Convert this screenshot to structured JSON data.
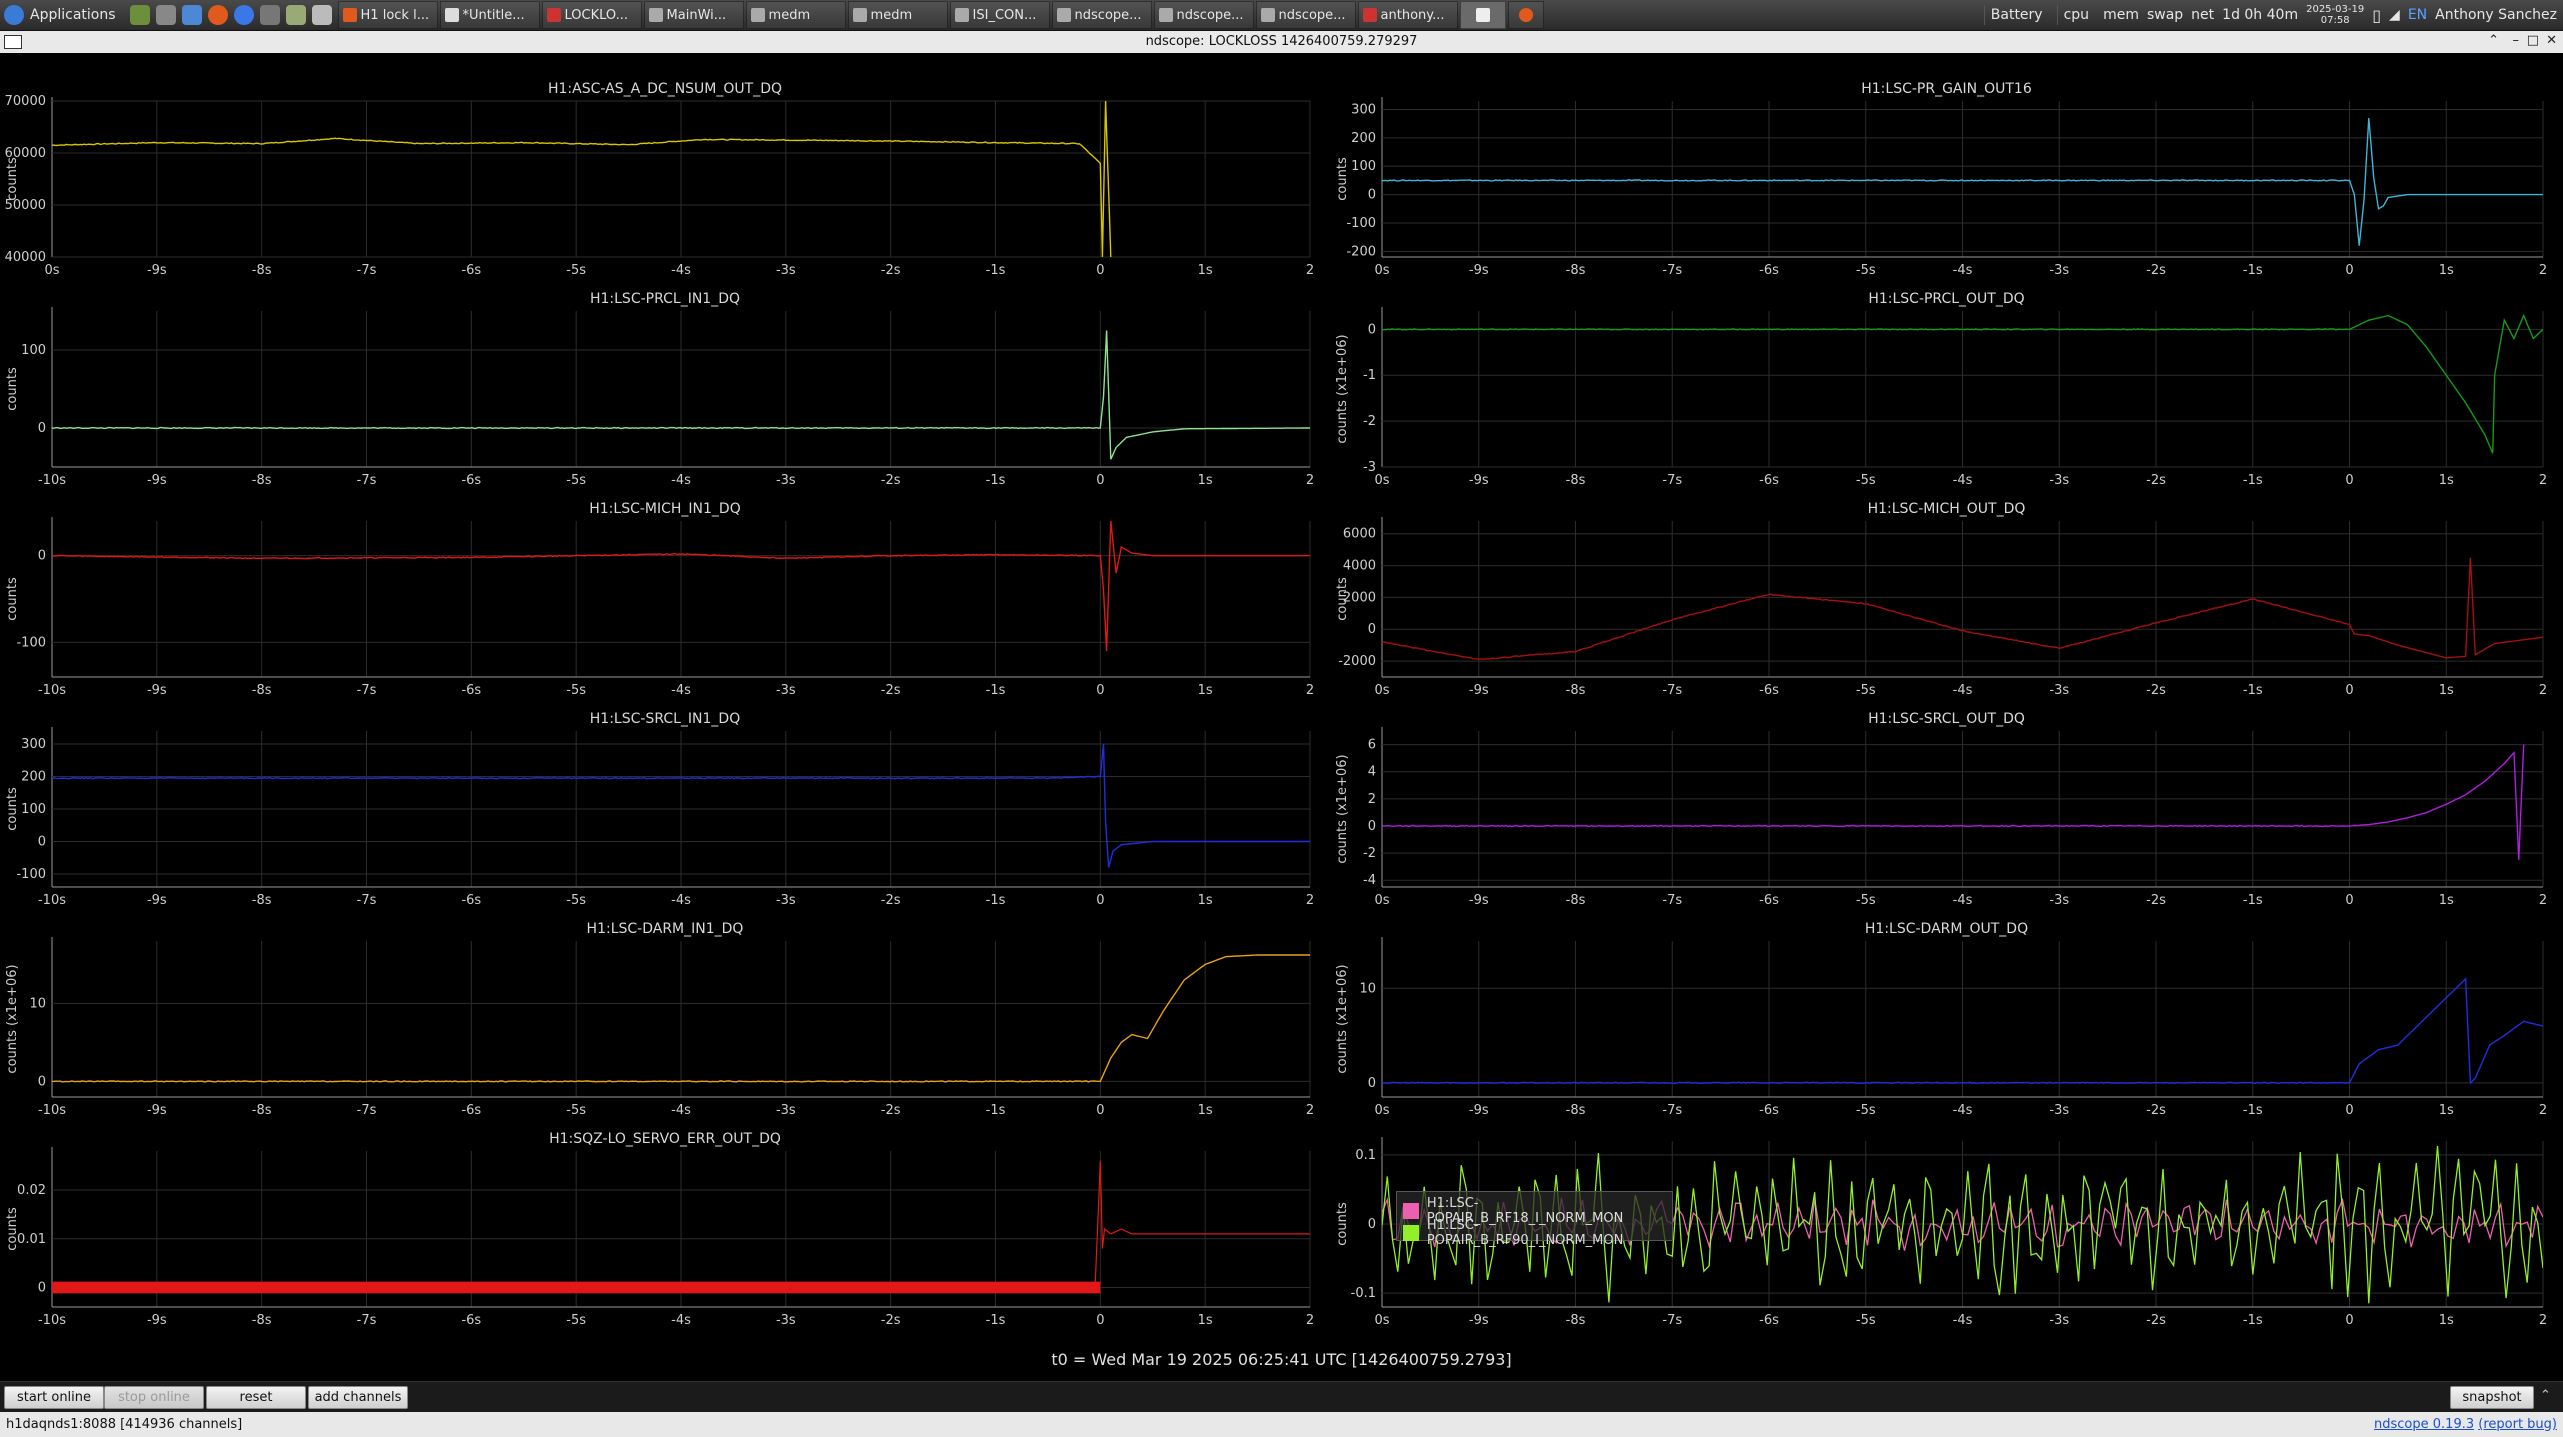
{
  "taskbar": {
    "apps_label": "Applications",
    "tasks": [
      "H1 lock l...",
      "*Untitle...",
      "LOCKLO...",
      "MainWi...",
      "medm",
      "medm",
      "ISI_CON...",
      "ndscope...",
      "ndscope...",
      "ndscope...",
      "anthony..."
    ],
    "tray": [
      "Battery",
      "cpu",
      "mem",
      "swap",
      "net"
    ],
    "uptime": "1d 0h 40m",
    "date": "2025-03-19",
    "time": "07:58",
    "lang": "EN",
    "user": "Anthony Sanchez"
  },
  "window": {
    "title": "ndscope: LOCKLOSS 1426400759.279297",
    "min_icon": "minimize-icon",
    "max_icon": "maximize-icon",
    "close_icon": "close-icon"
  },
  "colors": {
    "background": "#000000",
    "grid": "#2c2c2c",
    "axis_text": "#cfcfcf",
    "yellow": "#d8c400",
    "cyan": "#3fb4d6",
    "lightgreen": "#8fe28f",
    "darkgreen": "#169a16",
    "red": "#e01818",
    "darkred": "#a51010",
    "blue": "#1f2fe0",
    "purple": "#b01ce0",
    "orange": "#e9a216",
    "pink": "#ec5fb1",
    "lime": "#92ef2a"
  },
  "ylabel_counts": "counts",
  "ylabel_scaled": "counts (x1e+06)",
  "xaxis_left": {
    "ticks": [
      "-10s",
      "-9s",
      "-8s",
      "-7s",
      "-6s",
      "-5s",
      "-4s",
      "-3s",
      "-2s",
      "-1s",
      "0",
      "1s",
      "2"
    ],
    "values": [
      -10,
      -9,
      -8,
      -7,
      -6,
      -5,
      -4,
      -3,
      -2,
      -1,
      0,
      1,
      2
    ],
    "first_tick_truncated": "0s"
  },
  "xaxis_right": {
    "ticks": [
      "-10s",
      "-9s",
      "-8s",
      "-7s",
      "-6s",
      "-5s",
      "-4s",
      "-3s",
      "-2s",
      "-1s",
      "0",
      "1s",
      "2"
    ],
    "values": [
      -10,
      -9,
      -8,
      -7,
      -6,
      -5,
      -4,
      -3,
      -2,
      -1,
      0,
      1,
      2
    ],
    "first_tick_truncated": "0s"
  },
  "legend": {
    "items": [
      {
        "label": "H1:LSC-POPAIR_B_RF18_I_NORM_MON",
        "color": "#ec5fb1"
      },
      {
        "label": "H1:LSC-POPAIR_B_RF90_I_NORM_MON",
        "color": "#92ef2a"
      }
    ]
  },
  "chart_data": [
    {
      "type": "line",
      "title": "H1:ASC-AS_A_DC_NSUM_OUT_DQ",
      "ylabel": "counts",
      "yticks": [
        "70000",
        "60000",
        "50000",
        "40000"
      ],
      "ylim": [
        40000,
        70000
      ],
      "xlim": [
        -10,
        2
      ],
      "first_x_label": "0s",
      "color": "#d8c400",
      "x": [
        -10,
        -9,
        -8,
        -7.3,
        -6.5,
        -5.5,
        -4.5,
        -3.8,
        -3,
        -2,
        -1,
        -0.2,
        0,
        0.02,
        0.05,
        0.1
      ],
      "y": [
        61500,
        62000,
        61800,
        62800,
        61800,
        62000,
        61600,
        62600,
        62500,
        62300,
        62000,
        61800,
        58000,
        40000,
        70000,
        40000
      ]
    },
    {
      "type": "line",
      "title": "H1:LSC-PR_GAIN_OUT16",
      "ylabel": "counts",
      "yticks": [
        "300",
        "200",
        "100",
        "0",
        "-100",
        "-200"
      ],
      "ylim": [
        -220,
        330
      ],
      "xlim": [
        -10,
        2
      ],
      "first_x_label": "0s",
      "color": "#3fb4d6",
      "x": [
        -10,
        0,
        0.05,
        0.1,
        0.15,
        0.2,
        0.25,
        0.3,
        0.35,
        0.4,
        0.6,
        2
      ],
      "y": [
        50,
        50,
        0,
        -180,
        -20,
        270,
        60,
        -50,
        -40,
        -10,
        0,
        0
      ]
    },
    {
      "type": "line",
      "title": "H1:LSC-PRCL_IN1_DQ",
      "ylabel": "counts",
      "yticks": [
        "100",
        "0"
      ],
      "ylim": [
        -50,
        150
      ],
      "xlim": [
        -10,
        2
      ],
      "first_x_label": "-10s",
      "color": "#8fe28f",
      "x": [
        -10,
        -5,
        0,
        0.03,
        0.06,
        0.1,
        0.15,
        0.25,
        0.5,
        0.8,
        2
      ],
      "y": [
        0,
        0,
        0,
        40,
        125,
        -40,
        -25,
        -12,
        -5,
        -1,
        0
      ]
    },
    {
      "type": "line",
      "title": "H1:LSC-PRCL_OUT_DQ",
      "ylabel": "counts (x1e+06)",
      "yticks": [
        "0",
        "-1",
        "-2",
        "-3"
      ],
      "ylim": [
        -3,
        0.4
      ],
      "xlim": [
        -10,
        2
      ],
      "first_x_label": "0s",
      "color": "#169a16",
      "x": [
        -10,
        0,
        0.2,
        0.4,
        0.6,
        0.8,
        1.0,
        1.2,
        1.4,
        1.48,
        1.5,
        1.6,
        1.7,
        1.8,
        1.9,
        2.0
      ],
      "y": [
        0,
        0,
        0.2,
        0.3,
        0.1,
        -0.4,
        -1.0,
        -1.6,
        -2.3,
        -2.7,
        -1.0,
        0.2,
        -0.2,
        0.3,
        -0.2,
        0
      ]
    },
    {
      "type": "line",
      "title": "H1:LSC-MICH_IN1_DQ",
      "ylabel": "counts",
      "yticks": [
        "0",
        "-100"
      ],
      "ylim": [
        -140,
        40
      ],
      "xlim": [
        -10,
        2
      ],
      "first_x_label": "-10s",
      "color": "#e01818",
      "x": [
        -10,
        -8,
        -6,
        -4,
        -3,
        -2,
        -1,
        0,
        0.03,
        0.06,
        0.1,
        0.15,
        0.2,
        0.3,
        0.5,
        2
      ],
      "y": [
        0,
        -3,
        -2,
        2,
        -3,
        0,
        1,
        0,
        -40,
        -110,
        40,
        -20,
        10,
        3,
        0,
        0
      ]
    },
    {
      "type": "line",
      "title": "H1:LSC-MICH_OUT_DQ",
      "ylabel": "counts",
      "yticks": [
        "6000",
        "4000",
        "2000",
        "0",
        "-2000"
      ],
      "ylim": [
        -3000,
        6800
      ],
      "xlim": [
        -10,
        2
      ],
      "first_x_label": "0s",
      "color": "#a51010",
      "x": [
        -10,
        -9,
        -8,
        -7,
        -6,
        -5,
        -4,
        -3,
        -2,
        -1,
        0,
        0.05,
        0.2,
        0.5,
        1.0,
        1.2,
        1.25,
        1.3,
        1.5,
        2.0
      ],
      "y": [
        -800,
        -1900,
        -1400,
        600,
        2200,
        1600,
        -100,
        -1200,
        400,
        1900,
        300,
        -300,
        -400,
        -1000,
        -1800,
        -1700,
        4500,
        -1600,
        -900,
        -500
      ]
    },
    {
      "type": "line",
      "title": "H1:LSC-SRCL_IN1_DQ",
      "ylabel": "counts",
      "yticks": [
        "300",
        "200",
        "100",
        "0",
        "-100"
      ],
      "ylim": [
        -140,
        340
      ],
      "xlim": [
        -10,
        2
      ],
      "first_x_label": "-10s",
      "color": "#1f2fe0",
      "x": [
        -10,
        -5,
        -0.5,
        0,
        0.03,
        0.05,
        0.08,
        0.12,
        0.2,
        0.5,
        1,
        2
      ],
      "y": [
        195,
        195,
        195,
        200,
        300,
        60,
        -80,
        -30,
        -10,
        0,
        0,
        0
      ]
    },
    {
      "type": "line",
      "title": "H1:LSC-SRCL_OUT_DQ",
      "ylabel": "counts (x1e+06)",
      "yticks": [
        "6",
        "4",
        "2",
        "0",
        "-2",
        "-4"
      ],
      "ylim": [
        -4.5,
        7
      ],
      "xlim": [
        -10,
        2
      ],
      "first_x_label": "0s",
      "color": "#b01ce0",
      "x": [
        -10,
        0,
        0.2,
        0.4,
        0.6,
        0.8,
        1.0,
        1.2,
        1.4,
        1.6,
        1.7,
        1.75,
        1.8
      ],
      "y": [
        0,
        0,
        0.1,
        0.3,
        0.6,
        1.0,
        1.6,
        2.3,
        3.3,
        4.6,
        5.4,
        -2.5,
        6.0
      ]
    },
    {
      "type": "line",
      "title": "H1:LSC-DARM_IN1_DQ",
      "ylabel": "counts (x1e+06)",
      "yticks": [
        "10",
        "0"
      ],
      "ylim": [
        -2,
        18
      ],
      "xlim": [
        -10,
        2
      ],
      "first_x_label": "-10s",
      "color": "#e9a216",
      "x": [
        -10,
        0,
        0.1,
        0.2,
        0.3,
        0.45,
        0.6,
        0.8,
        1.0,
        1.2,
        1.5,
        2
      ],
      "y": [
        0,
        0,
        3,
        5,
        6,
        5.5,
        9,
        13,
        15,
        16,
        16.2,
        16.2
      ]
    },
    {
      "type": "line",
      "title": "H1:LSC-DARM_OUT_DQ",
      "ylabel": "counts (x1e+06)",
      "yticks": [
        "10",
        "0"
      ],
      "ylim": [
        -1.5,
        15
      ],
      "xlim": [
        -10,
        2
      ],
      "first_x_label": "0s",
      "color": "#1f2fe0",
      "x": [
        -10,
        0,
        0.1,
        0.3,
        0.5,
        0.8,
        1.0,
        1.2,
        1.25,
        1.3,
        1.45,
        1.6,
        1.8,
        2.0
      ],
      "y": [
        0,
        0,
        2,
        3.5,
        4,
        7,
        9,
        11,
        0,
        0.5,
        4,
        5,
        6.5,
        6
      ]
    },
    {
      "type": "line",
      "title": "H1:SQZ-LO_SERVO_ERR_OUT_DQ",
      "ylabel": "counts",
      "yticks": [
        "0.02",
        "0.01",
        "0"
      ],
      "ylim": [
        -0.004,
        0.028
      ],
      "xlim": [
        -10,
        2
      ],
      "first_x_label": "-10s",
      "color": "#e01818",
      "x": [
        -10,
        -5,
        -0.05,
        0,
        0.02,
        0.04,
        0.1,
        0.2,
        0.3,
        0.5,
        2
      ],
      "y": [
        0,
        0,
        0,
        0.026,
        0.008,
        0.012,
        0.011,
        0.012,
        0.011,
        0.011,
        0.011
      ]
    },
    {
      "type": "line",
      "title": "",
      "ylabel": "counts",
      "yticks": [
        "0.1",
        "0",
        "-0.1"
      ],
      "ylim": [
        -0.12,
        0.12
      ],
      "xlim": [
        -10,
        2
      ],
      "first_x_label": "0s",
      "series": [
        {
          "name": "H1:LSC-POPAIR_B_RF18_I_NORM_MON",
          "color": "#ec5fb1",
          "amplitude": 0.03
        },
        {
          "name": "H1:LSC-POPAIR_B_RF90_I_NORM_MON",
          "color": "#92ef2a",
          "amplitude": 0.095
        }
      ]
    }
  ],
  "t0_label": "t0 = Wed Mar 19 2025 06:25:41 UTC [1426400759.2793]",
  "controls": {
    "start_online": "start online",
    "stop_online": "stop online",
    "reset": "reset",
    "add_channels": "add channels",
    "snapshot": "snapshot"
  },
  "status": {
    "server": "h1daqnds1:8088  [414936 channels]",
    "version_link": "ndscope 0.19.3",
    "report_bug": "(report bug)"
  }
}
